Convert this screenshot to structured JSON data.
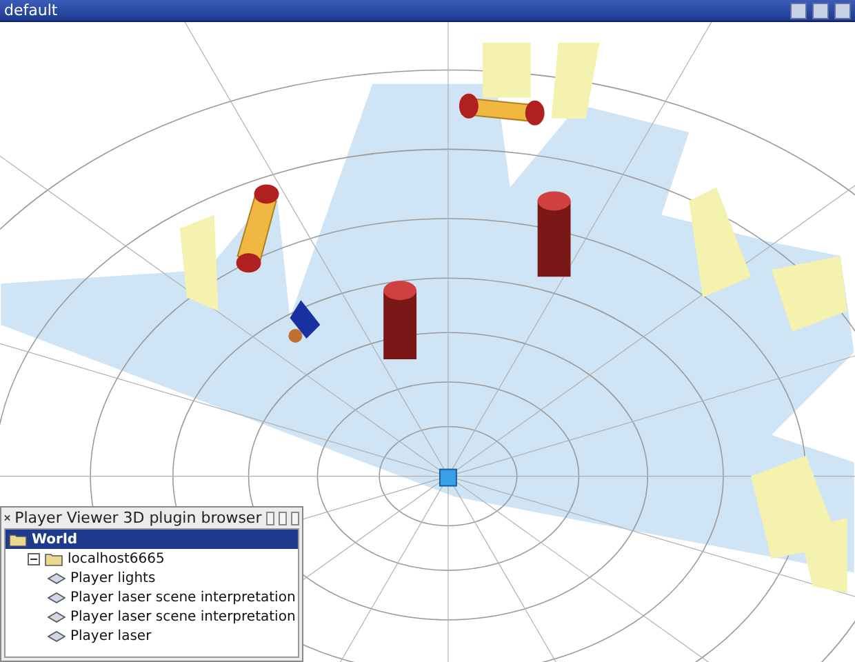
{
  "window": {
    "title": "default"
  },
  "plugin_browser": {
    "title": "Player Viewer 3D plugin browser",
    "tree": [
      {
        "label": "World",
        "kind": "folder",
        "selected": true,
        "children": [
          {
            "label": "localhost6665",
            "kind": "folder",
            "selected": false,
            "expanded": true,
            "children": [
              {
                "label": "Player lights",
                "kind": "plugin",
                "selected": false
              },
              {
                "label": "Player laser scene interpretation",
                "kind": "plugin",
                "selected": false
              },
              {
                "label": "Player laser scene interpretation",
                "kind": "plugin",
                "selected": false
              },
              {
                "label": "Player laser",
                "kind": "plugin",
                "selected": false
              }
            ]
          }
        ]
      }
    ]
  }
}
